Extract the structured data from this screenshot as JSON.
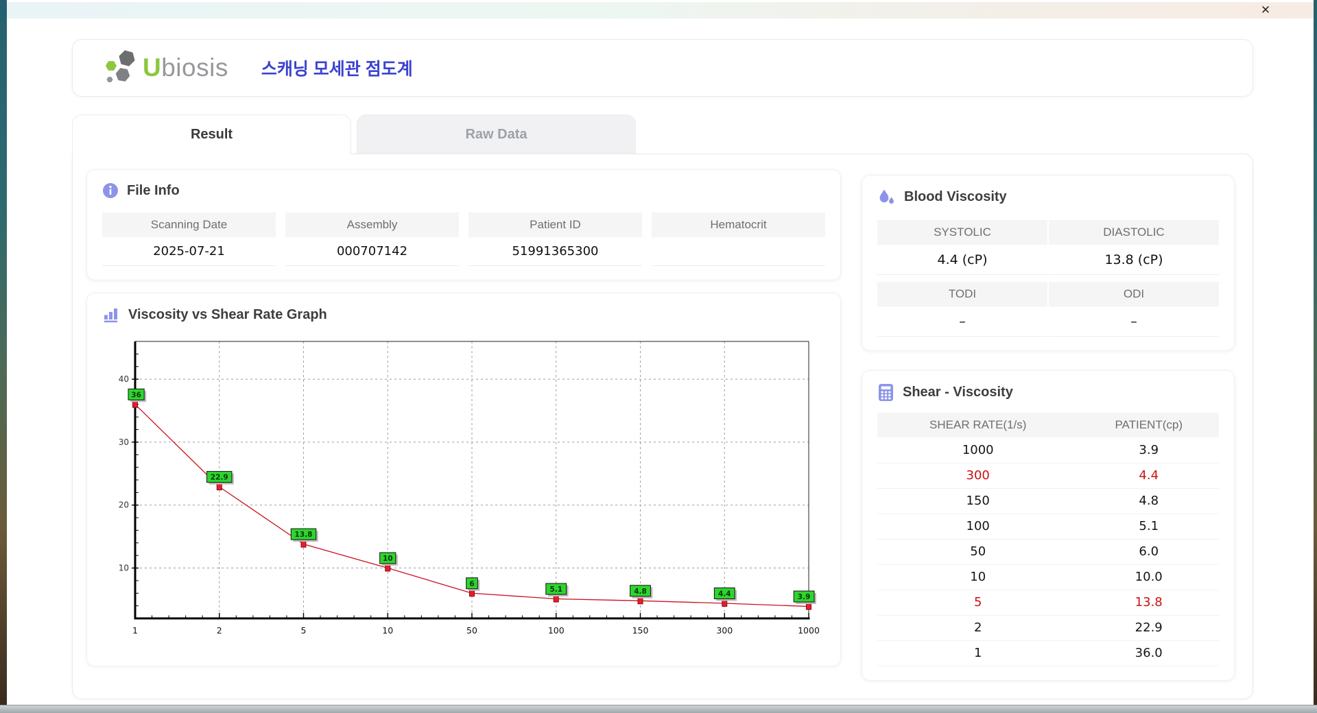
{
  "window": {
    "close_label": "✕"
  },
  "header": {
    "logo_u": "U",
    "logo_rest": "biosis",
    "app_title": "스캐닝 모세관 점도계"
  },
  "tabs": {
    "result": "Result",
    "raw_data": "Raw Data"
  },
  "file_info": {
    "title": "File Info",
    "fields": [
      {
        "label": "Scanning Date",
        "value": "2025-07-21"
      },
      {
        "label": "Assembly",
        "value": "000707142"
      },
      {
        "label": "Patient ID",
        "value": "51991365300"
      },
      {
        "label": "Hematocrit",
        "value": ""
      }
    ]
  },
  "blood_viscosity": {
    "title": "Blood Viscosity",
    "systolic_label": "SYSTOLIC",
    "systolic_value": "4.4 (cP)",
    "diastolic_label": "DIASTOLIC",
    "diastolic_value": "13.8 (cP)",
    "todi_label": "TODI",
    "todi_value": "–",
    "odi_label": "ODI",
    "odi_value": "–"
  },
  "graph": {
    "title": "Viscosity vs Shear Rate Graph"
  },
  "chart_data": {
    "type": "line",
    "title": "Viscosity vs Shear Rate Graph",
    "categories": [
      "1",
      "2",
      "5",
      "10",
      "50",
      "100",
      "150",
      "300",
      "1000"
    ],
    "values": [
      36,
      22.9,
      13.8,
      10,
      6,
      5.1,
      4.8,
      4.4,
      3.9
    ],
    "point_labels": [
      "36",
      "22.9",
      "13.8",
      "10",
      "6",
      "5.1",
      "4.8",
      "4.4",
      "3.9"
    ],
    "y_ticks": [
      10,
      20,
      30,
      40
    ],
    "ylim": [
      2,
      46
    ],
    "x_axis_type": "categorical-equal-spacing",
    "grid": "dashed",
    "legend": "none",
    "xlabel": "",
    "ylabel": "",
    "line_color": "#cc1122",
    "marker_color": "#ea1c2d",
    "marker_border": "#8a0a14",
    "label_box_color": "#2fd42f",
    "grid_color": "#9b9b9b"
  },
  "shear_table": {
    "title": "Shear - Viscosity",
    "columns": [
      "SHEAR RATE(1/s)",
      "PATIENT(cp)"
    ],
    "highlight_color": "#cc1111",
    "rows": [
      {
        "rate": "1000",
        "patient": "3.9",
        "highlight": false
      },
      {
        "rate": "300",
        "patient": "4.4",
        "highlight": true
      },
      {
        "rate": "150",
        "patient": "4.8",
        "highlight": false
      },
      {
        "rate": "100",
        "patient": "5.1",
        "highlight": false
      },
      {
        "rate": "50",
        "patient": "6.0",
        "highlight": false
      },
      {
        "rate": "10",
        "patient": "10.0",
        "highlight": false
      },
      {
        "rate": "5",
        "patient": "13.8",
        "highlight": true
      },
      {
        "rate": "2",
        "patient": "22.9",
        "highlight": false
      },
      {
        "rate": "1",
        "patient": "36.0",
        "highlight": false
      }
    ]
  }
}
